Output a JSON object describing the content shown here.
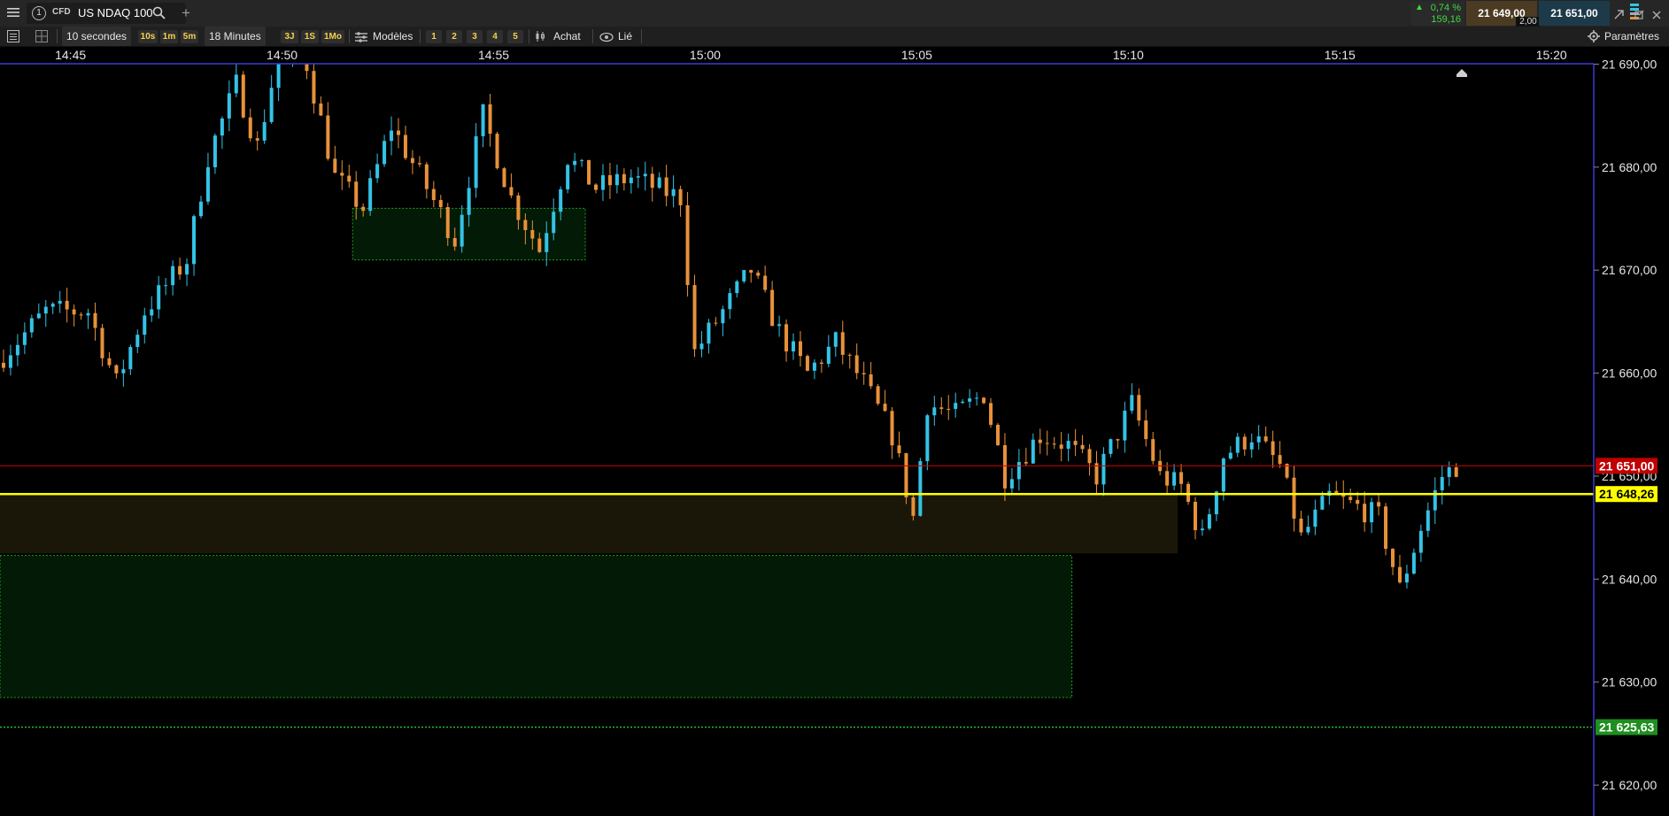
{
  "header": {
    "menu_icon": "hamburger-icon",
    "tab_number": "1",
    "instrument_type": "CFD",
    "instrument_name": "US NDAQ 100",
    "search_icon": "search-icon",
    "add_tab": "+",
    "change_percent": "0,74 %",
    "change_points": "159,16",
    "bid": "21 649,00",
    "spread": "2,00",
    "ask": "21 651,00"
  },
  "toolbar": {
    "interval_label": "10 secondes",
    "intervals": [
      "10s",
      "1m",
      "5m"
    ],
    "period_label": "18 Minutes",
    "periods": [
      "3J",
      "1S",
      "1Mo"
    ],
    "templates_label": "Modèles",
    "layouts": [
      "1",
      "2",
      "3",
      "4",
      "5"
    ],
    "buy_label": "Achat",
    "linked_label": "Lié",
    "settings_label": "Paramètres"
  },
  "colors": {
    "bullish": "#33c3e6",
    "bearish": "#e8913a",
    "current_price_line": "#d40000",
    "support_line": "#ffff00",
    "level_line": "#2dbb2d",
    "axis_line": "#3b3bdb"
  },
  "chart_data": {
    "type": "candlestick",
    "instrument": "US NDAQ 100",
    "x_ticks": [
      "14:45",
      "14:50",
      "14:55",
      "15:00",
      "15:05",
      "15:10",
      "15:15",
      "15:20"
    ],
    "y_ticks": [
      "21 690,00",
      "21 680,00",
      "21 670,00",
      "21 660,00",
      "21 650,00",
      "21 640,00",
      "21 630,00",
      "21 620,00"
    ],
    "ylim": [
      21617,
      21691.5
    ],
    "xlim": [
      "14:43:20",
      "15:21:00"
    ],
    "candle_interval_seconds": 10,
    "price_tags": [
      {
        "name": "current",
        "value": "21 651,00",
        "level": 21651.0
      },
      {
        "name": "support",
        "value": "21 648,26",
        "level": 21648.26
      },
      {
        "name": "target",
        "value": "21 625,63",
        "level": 21625.63
      }
    ],
    "zones": [
      {
        "from_time": "14:51:40",
        "to_time": "14:57:10",
        "low": 21671.0,
        "high": 21676.0
      },
      {
        "from_time": "14:43:20",
        "to_time": "15:08:40",
        "low": 21628.5,
        "high": 21642.3
      },
      {
        "from_time": "14:43:20",
        "to_time": "15:11:10",
        "low": 21642.5,
        "high": 21648.26
      }
    ],
    "candle_color_scheme": {
      "up": "cyan",
      "down": "orange"
    },
    "anchors": [
      {
        "time": "14:43:20",
        "price": 21661
      },
      {
        "time": "14:44:30",
        "price": 21666
      },
      {
        "time": "14:45:30",
        "price": 21666
      },
      {
        "time": "14:46:10",
        "price": 21659
      },
      {
        "time": "14:46:50",
        "price": 21666
      },
      {
        "time": "14:47:50",
        "price": 21671
      },
      {
        "time": "14:48:20",
        "price": 21681
      },
      {
        "time": "14:49:00",
        "price": 21688
      },
      {
        "time": "14:49:30",
        "price": 21682
      },
      {
        "time": "14:50:00",
        "price": 21691
      },
      {
        "time": "14:50:40",
        "price": 21690
      },
      {
        "time": "14:51:20",
        "price": 21679
      },
      {
        "time": "14:52:00",
        "price": 21676
      },
      {
        "time": "14:52:40",
        "price": 21684
      },
      {
        "time": "14:53:30",
        "price": 21678
      },
      {
        "time": "14:54:10",
        "price": 21673
      },
      {
        "time": "14:54:50",
        "price": 21685
      },
      {
        "time": "14:55:30",
        "price": 21677
      },
      {
        "time": "14:56:10",
        "price": 21672
      },
      {
        "time": "14:56:50",
        "price": 21681
      },
      {
        "time": "14:57:30",
        "price": 21678
      },
      {
        "time": "14:58:20",
        "price": 21679
      },
      {
        "time": "14:59:30",
        "price": 21677
      },
      {
        "time": "14:59:50",
        "price": 21662
      },
      {
        "time": "15:00:30",
        "price": 21666
      },
      {
        "time": "15:01:10",
        "price": 21670
      },
      {
        "time": "15:01:50",
        "price": 21664
      },
      {
        "time": "15:02:30",
        "price": 21660
      },
      {
        "time": "15:03:10",
        "price": 21663
      },
      {
        "time": "15:03:50",
        "price": 21659
      },
      {
        "time": "15:04:30",
        "price": 21654
      },
      {
        "time": "15:05:00",
        "price": 21646
      },
      {
        "time": "15:05:20",
        "price": 21657
      },
      {
        "time": "15:06:00",
        "price": 21656
      },
      {
        "time": "15:06:40",
        "price": 21658
      },
      {
        "time": "15:07:10",
        "price": 21650
      },
      {
        "time": "15:08:00",
        "price": 21654
      },
      {
        "time": "15:08:40",
        "price": 21653
      },
      {
        "time": "15:09:20",
        "price": 21650
      },
      {
        "time": "15:10:10",
        "price": 21657
      },
      {
        "time": "15:10:50",
        "price": 21650
      },
      {
        "time": "15:11:20",
        "price": 21649
      },
      {
        "time": "15:11:50",
        "price": 21644
      },
      {
        "time": "15:12:20",
        "price": 21652
      },
      {
        "time": "15:13:00",
        "price": 21654
      },
      {
        "time": "15:13:40",
        "price": 21651
      },
      {
        "time": "15:14:10",
        "price": 21644
      },
      {
        "time": "15:14:50",
        "price": 21648
      },
      {
        "time": "15:15:30",
        "price": 21647
      },
      {
        "time": "15:16:00",
        "price": 21646
      },
      {
        "time": "15:16:30",
        "price": 21639
      },
      {
        "time": "15:17:00",
        "price": 21645
      },
      {
        "time": "15:17:30",
        "price": 21650
      },
      {
        "time": "15:17:50",
        "price": 21651
      }
    ]
  }
}
